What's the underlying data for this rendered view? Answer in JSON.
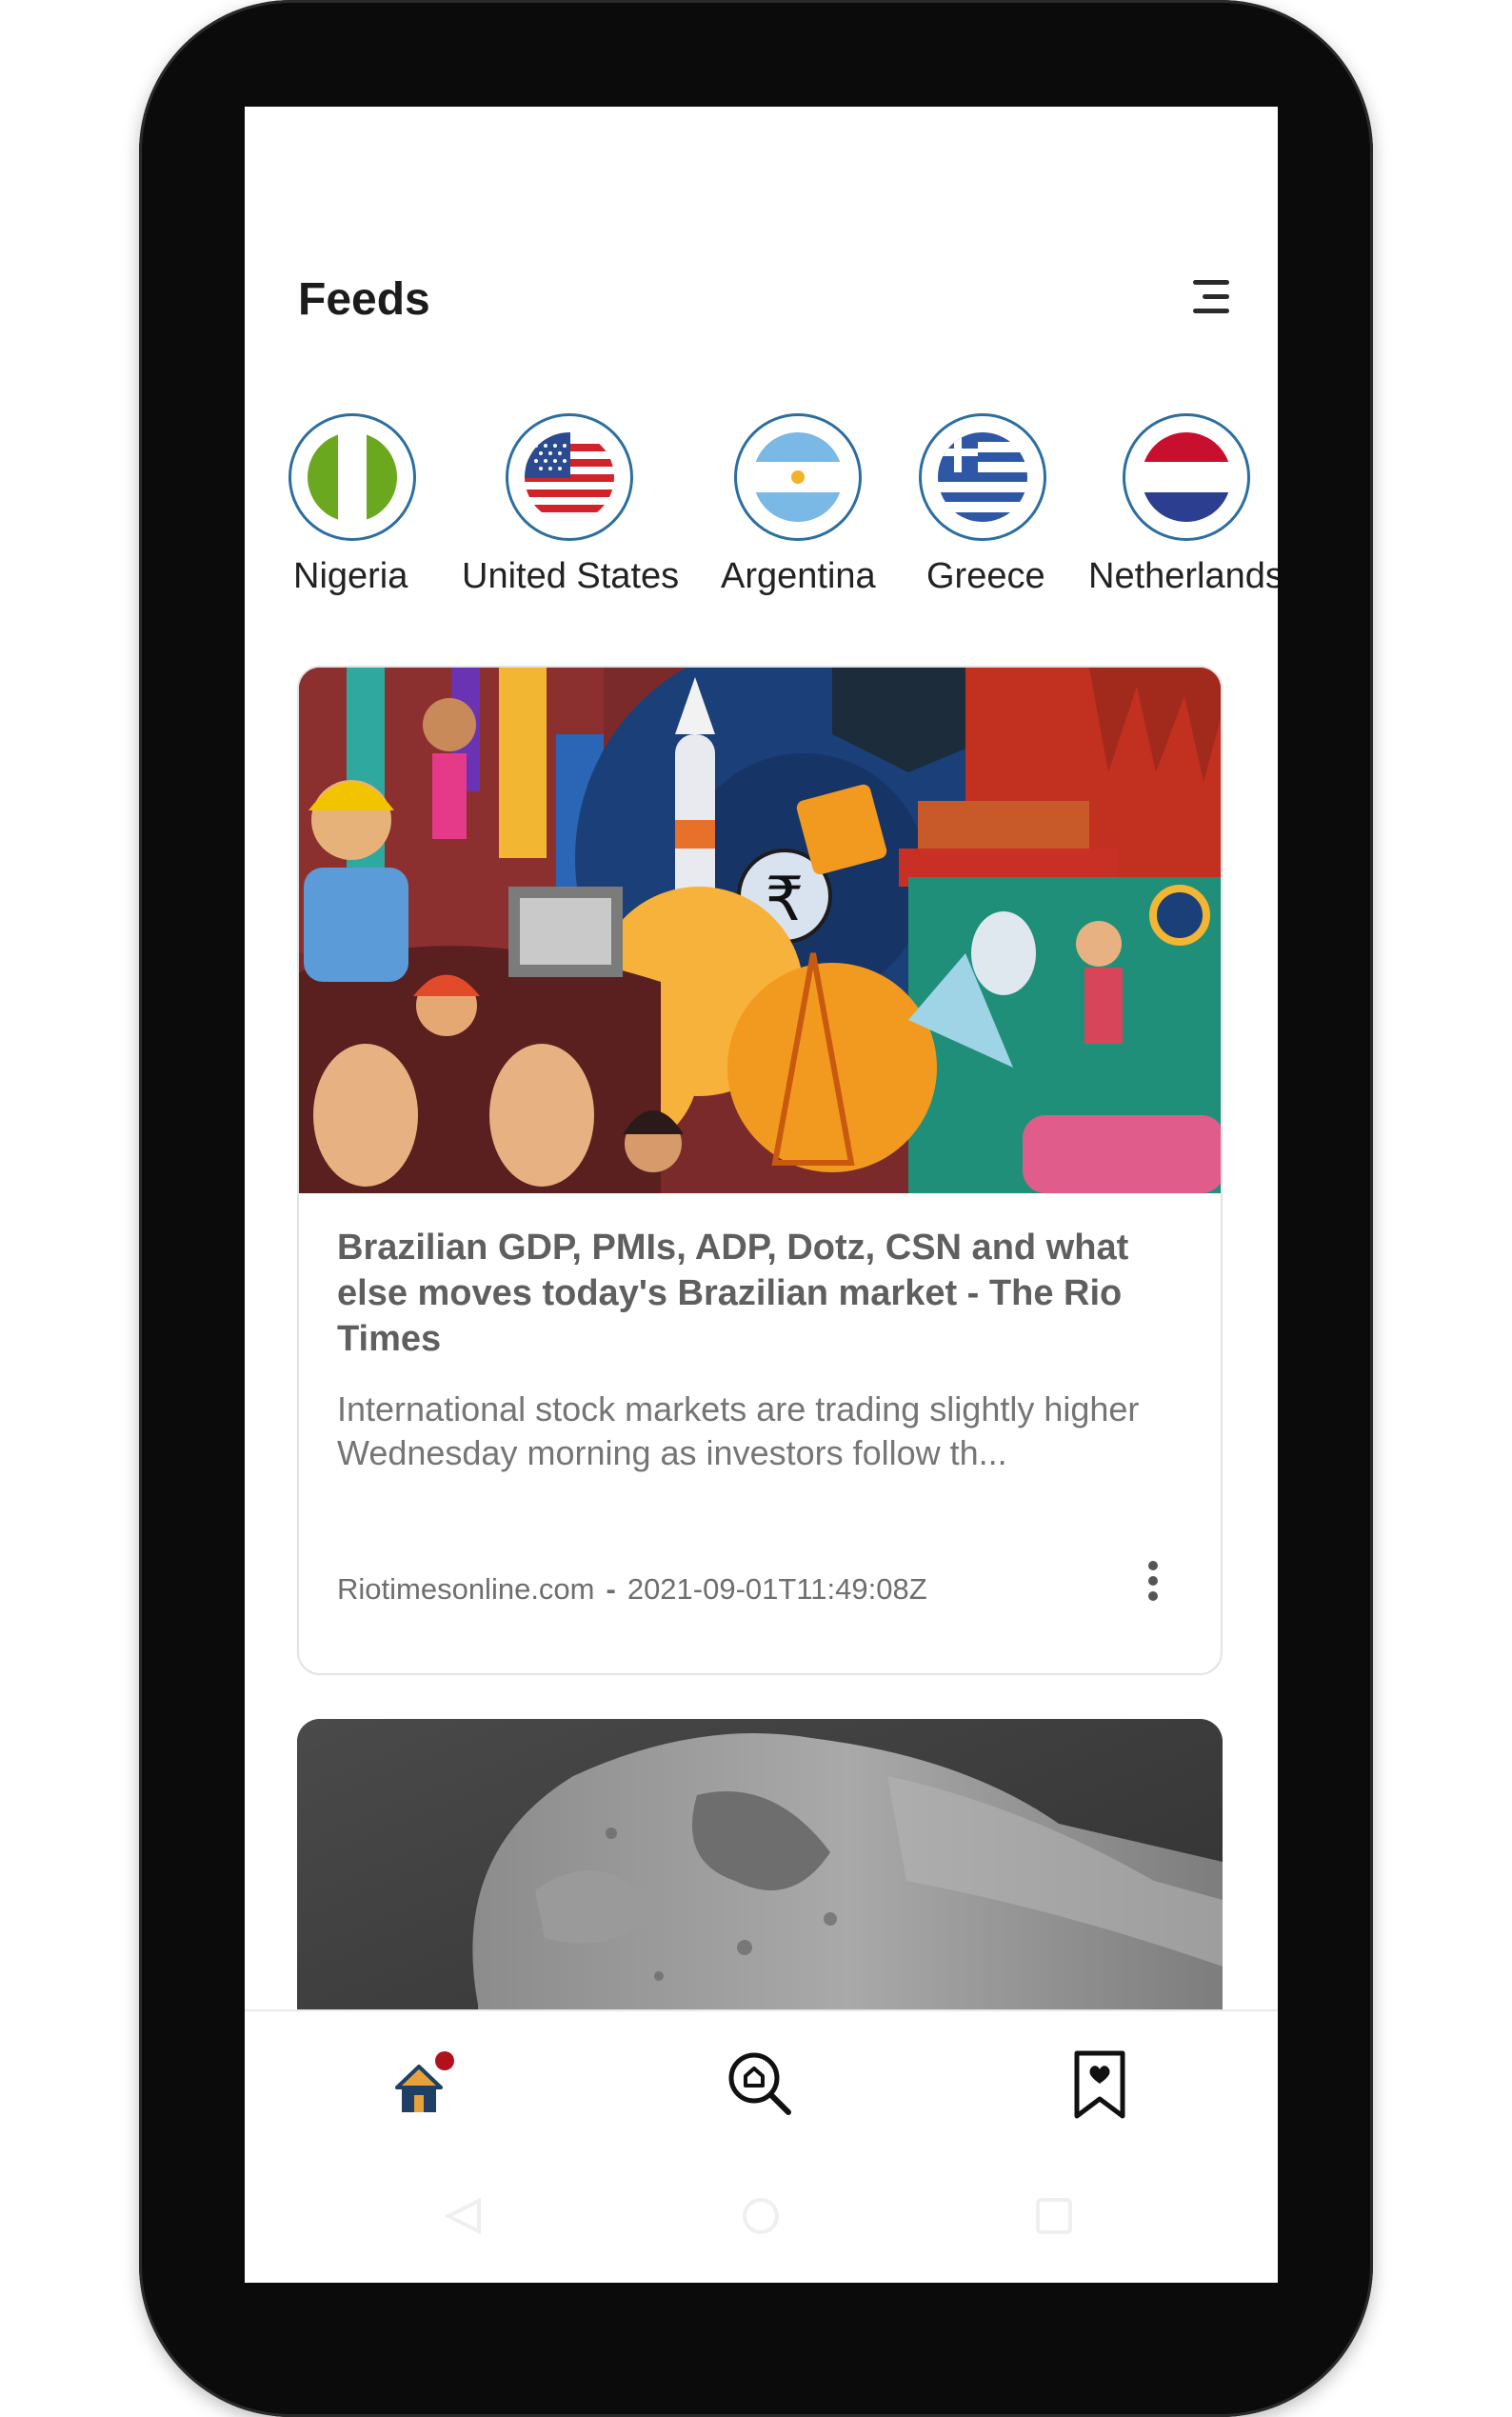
{
  "header": {
    "title": "Feeds"
  },
  "countries": [
    {
      "label": "Nigeria",
      "flag": "nigeria-flag"
    },
    {
      "label": "United States",
      "flag": "united-states-flag"
    },
    {
      "label": "Argentina",
      "flag": "argentina-flag"
    },
    {
      "label": "Greece",
      "flag": "greece-flag"
    },
    {
      "label": "Netherlands",
      "flag": "netherlands-flag"
    }
  ],
  "articles": [
    {
      "title": "Brazilian GDP, PMIs, ADP, Dotz, CSN and what else moves today's Brazilian market - The Rio Times",
      "description": "International stock markets are trading slightly higher Wednesday morning as investors follow th...",
      "source": "Riotimesonline.com",
      "separator": "-",
      "date": "2021-09-01T11:49:08Z"
    }
  ],
  "bottom_nav": {
    "items": [
      "home-icon",
      "explore-search-icon",
      "bookmark-heart-icon"
    ],
    "home_badge": true
  },
  "colors": {
    "accent": "#2c6ea0",
    "badge": "#b2101c",
    "home_roof": "#e8a13a",
    "home_body": "#1f3f64"
  }
}
